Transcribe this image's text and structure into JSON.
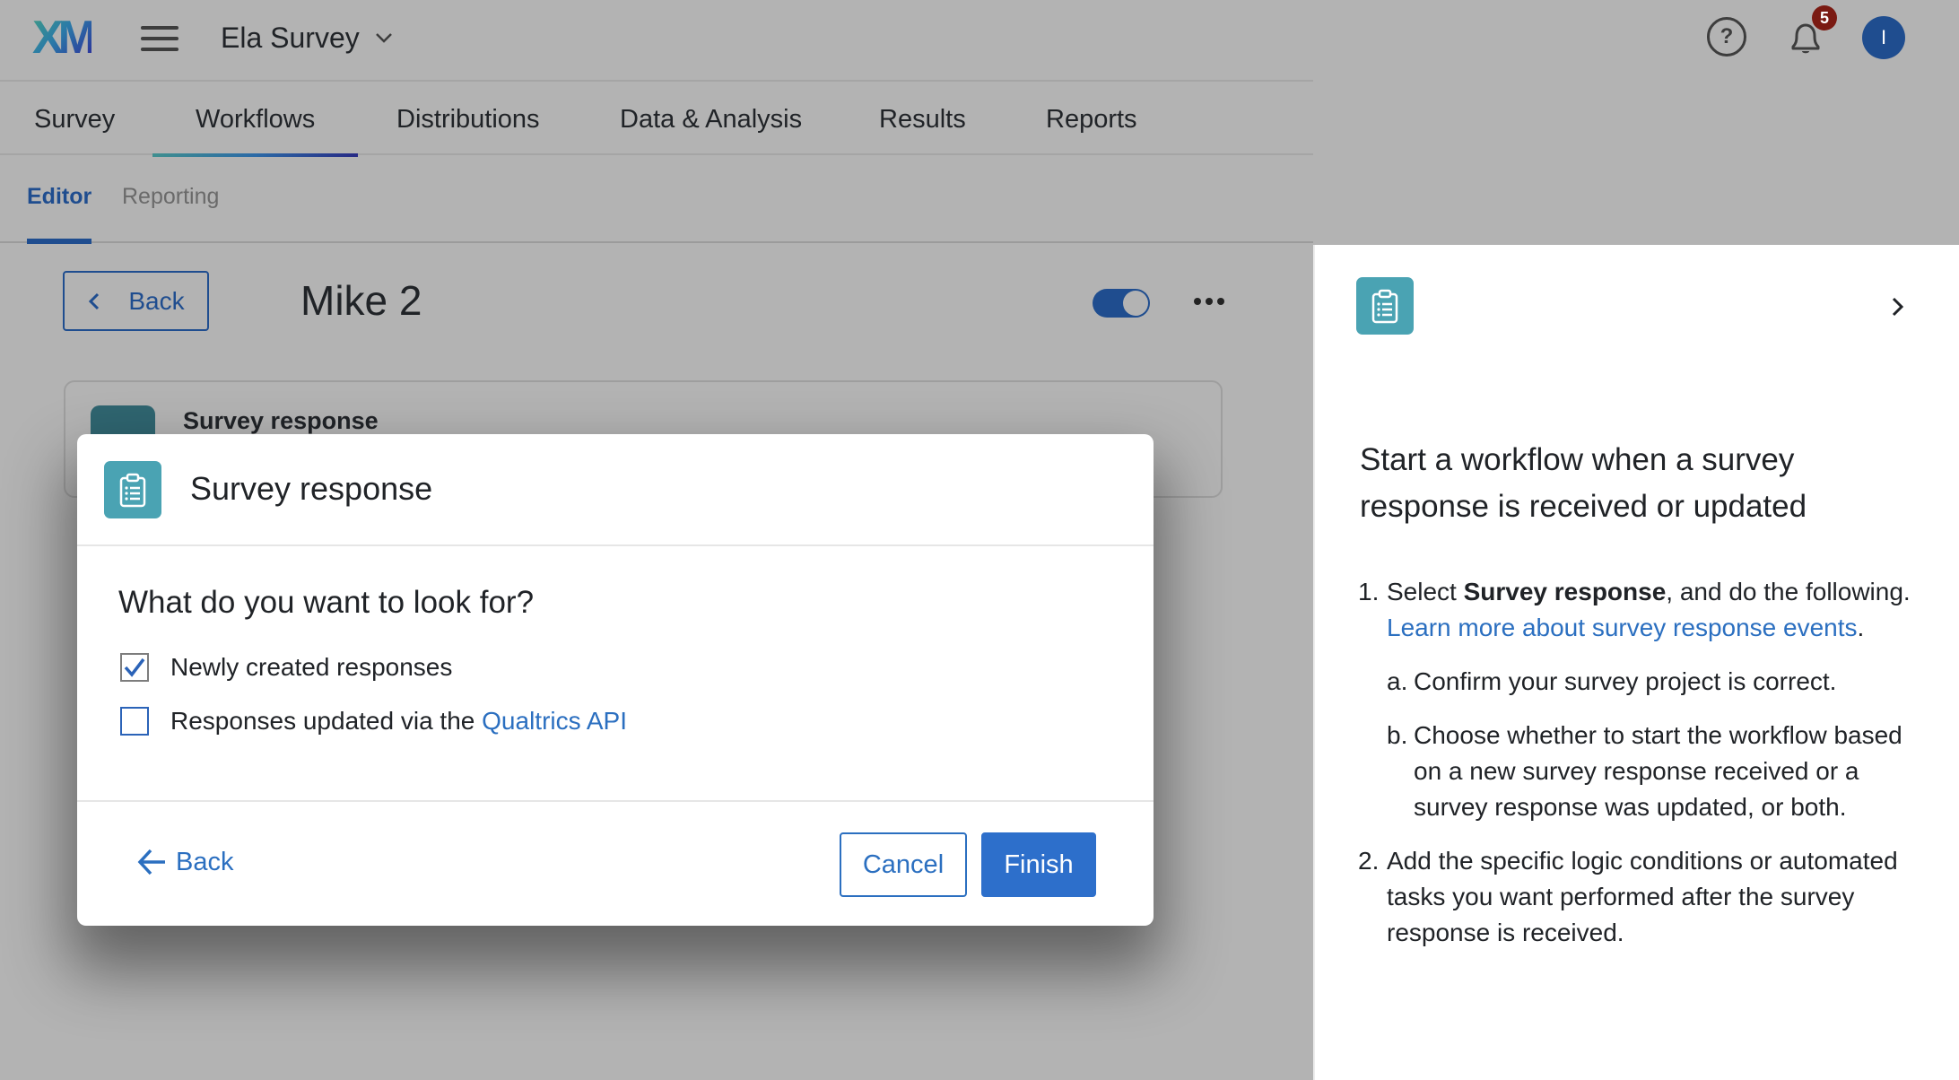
{
  "header": {
    "logo_text": "XM",
    "project_name": "Ela Survey",
    "notification_count": "5",
    "avatar_initial": "I",
    "icons": [
      "menu-icon",
      "chevron-down-icon",
      "help-icon",
      "bell-icon"
    ]
  },
  "main_tabs": [
    {
      "label": "Survey",
      "active": false
    },
    {
      "label": "Workflows",
      "active": true
    },
    {
      "label": "Distributions",
      "active": false
    },
    {
      "label": "Data & Analysis",
      "active": false
    },
    {
      "label": "Results",
      "active": false
    },
    {
      "label": "Reports",
      "active": false
    }
  ],
  "sub_tabs": [
    {
      "label": "Editor",
      "active": true
    },
    {
      "label": "Reporting",
      "active": false
    }
  ],
  "workflow": {
    "back_label": "Back",
    "title": "Mike 2",
    "enabled": true,
    "event_card_title": "Survey response"
  },
  "modal": {
    "title": "Survey response",
    "question": "What do you want to look for?",
    "options": [
      {
        "label": "Newly created responses",
        "link": "",
        "checked": true
      },
      {
        "label": "Responses updated via the ",
        "link": "Qualtrics API",
        "checked": false
      }
    ],
    "back_label": "Back",
    "cancel_label": "Cancel",
    "finish_label": "Finish"
  },
  "help_panel": {
    "title": "Start a workflow when a survey response is received or updated",
    "steps": [
      {
        "num": "1.",
        "prefix": "Select ",
        "bold": "Survey response",
        "suffix": ", and do the following. ",
        "link": "Learn more about survey response events",
        "after_link": ".",
        "substeps": [
          {
            "num": "a.",
            "text": "Confirm your survey project is correct."
          },
          {
            "num": "b.",
            "text": "Choose whether to start the workflow based on a new survey response received or a survey response was updated, or both."
          }
        ]
      },
      {
        "num": "2.",
        "text": "Add the specific logic conditions or automated tasks you want performed after the survey response is received."
      }
    ]
  },
  "colors": {
    "overlay_bg": "#b3b3b3",
    "brand_blue": "#1f4d8f",
    "link_blue": "#2b6fc0",
    "primary_button": "#2d6fcb",
    "event_icon_teal": "#4aa3b3",
    "badge_red": "#7a1a12"
  }
}
